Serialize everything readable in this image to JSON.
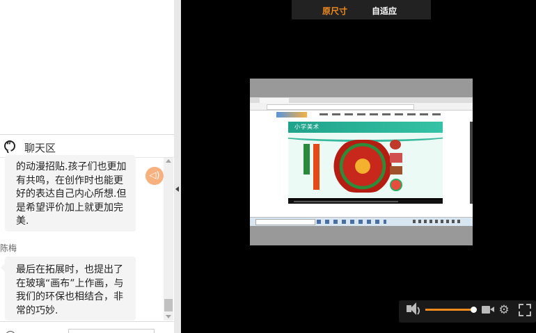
{
  "top_toggle": {
    "original_size_label": "原尺寸",
    "fit_label": "自适应",
    "active_color": "#f08c1e"
  },
  "chat": {
    "header_title": "聊天区",
    "messages": [
      {
        "sender": "",
        "text": "的动漫招贴.孩子们也更加有共鸣，在创作时也能更好的表达自己内心所想.但是希望评价加上就更加完美."
      },
      {
        "sender": "陈梅",
        "text": "最后在拓展时，也提出了在玻璃“画布”上作画，与我们的环保也相结合，非常的巧妙."
      }
    ]
  },
  "video": {
    "slide_title": "小学美术"
  },
  "player_controls": {
    "volume_percent": 96,
    "icons": [
      "volume-icon",
      "camera-icon",
      "gear-icon",
      "fullscreen-icon"
    ]
  }
}
